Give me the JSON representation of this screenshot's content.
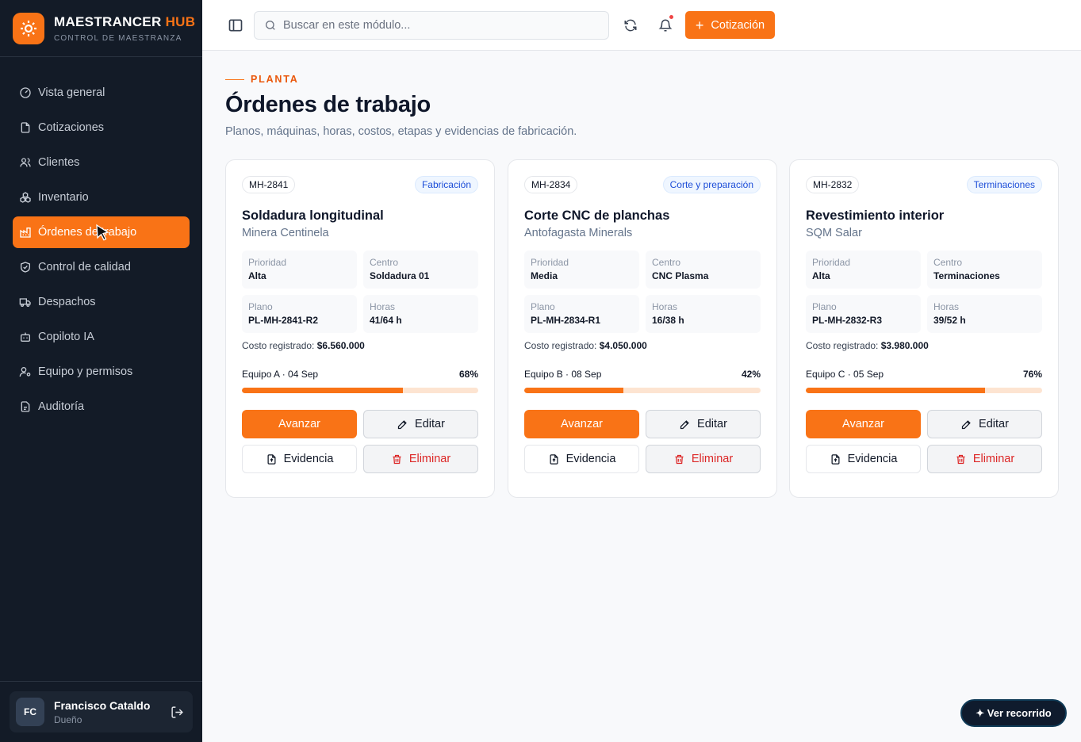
{
  "brand": {
    "name": "MAESTRANCER",
    "suffix": "HUB",
    "subtitle": "CONTROL DE MAESTRANZA"
  },
  "nav": {
    "items": [
      {
        "label": "Vista general",
        "icon": "gauge-icon"
      },
      {
        "label": "Cotizaciones",
        "icon": "file-icon"
      },
      {
        "label": "Clientes",
        "icon": "users-icon"
      },
      {
        "label": "Inventario",
        "icon": "boxes-icon"
      },
      {
        "label": "Órdenes de trabajo",
        "icon": "factory-icon",
        "active": true
      },
      {
        "label": "Control de calidad",
        "icon": "shield-check-icon"
      },
      {
        "label": "Despachos",
        "icon": "truck-icon"
      },
      {
        "label": "Copiloto IA",
        "icon": "bot-icon"
      },
      {
        "label": "Equipo y permisos",
        "icon": "user-cog-icon"
      },
      {
        "label": "Auditoría",
        "icon": "clipboard-icon"
      }
    ]
  },
  "user": {
    "initials": "FC",
    "name": "Francisco Cataldo",
    "role": "Dueño"
  },
  "topbar": {
    "search_placeholder": "Buscar en este módulo...",
    "cta_label": "Cotización"
  },
  "page": {
    "eyebrow": "PLANTA",
    "title": "Órdenes de trabajo",
    "subtitle": "Planos, máquinas, horas, costos, etapas y evidencias de fabricación."
  },
  "labels": {
    "priority": "Prioridad",
    "center": "Centro",
    "plan": "Plano",
    "hours": "Horas",
    "cost": "Costo registrado:",
    "advance": "Avanzar",
    "edit": "Editar",
    "evidence": "Evidencia",
    "delete": "Eliminar"
  },
  "orders": [
    {
      "code": "MH-2841",
      "stage": "Fabricación",
      "title": "Soldadura longitudinal",
      "client": "Minera Centinela",
      "priority": "Alta",
      "center": "Soldadura 01",
      "plan": "PL-MH-2841-R2",
      "hours": "41/64 h",
      "cost": "$6.560.000",
      "team": "Equipo A · 04 Sep",
      "progress_label": "68%",
      "progress": 68
    },
    {
      "code": "MH-2834",
      "stage": "Corte y preparación",
      "title": "Corte CNC de planchas",
      "client": "Antofagasta Minerals",
      "priority": "Media",
      "center": "CNC Plasma",
      "plan": "PL-MH-2834-R1",
      "hours": "16/38 h",
      "cost": "$4.050.000",
      "team": "Equipo B · 08 Sep",
      "progress_label": "42%",
      "progress": 42
    },
    {
      "code": "MH-2832",
      "stage": "Terminaciones",
      "title": "Revestimiento interior",
      "client": "SQM Salar",
      "priority": "Alta",
      "center": "Terminaciones",
      "plan": "PL-MH-2832-R3",
      "hours": "39/52 h",
      "cost": "$3.980.000",
      "team": "Equipo C · 05 Sep",
      "progress_label": "76%",
      "progress": 76
    }
  ],
  "tour": {
    "label": "✦ Ver recorrido"
  },
  "colors": {
    "accent": "#f97316",
    "sidebar": "#131b27",
    "danger": "#dc2626",
    "stage_badge": "#1d4ed8"
  }
}
